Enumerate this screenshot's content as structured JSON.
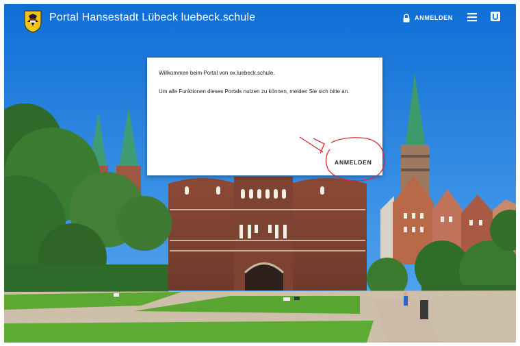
{
  "header": {
    "title": "Portal Hansestadt Lübeck luebeck.schule",
    "login_label": "ANMELDEN",
    "icons": [
      "crest-logo",
      "lock-icon",
      "menu-icon",
      "app-icon"
    ]
  },
  "card": {
    "welcome": "Willkommen beim Portal von ox.luebeck.schule.",
    "instruction": "Um alle Funktionen dieses Portals nutzen zu können, melden Sie sich bitte an.",
    "login_label": "ANMELDEN"
  },
  "colors": {
    "sky": "#1f86e0",
    "card": "#ffffff",
    "annotation": "#e0242a"
  }
}
